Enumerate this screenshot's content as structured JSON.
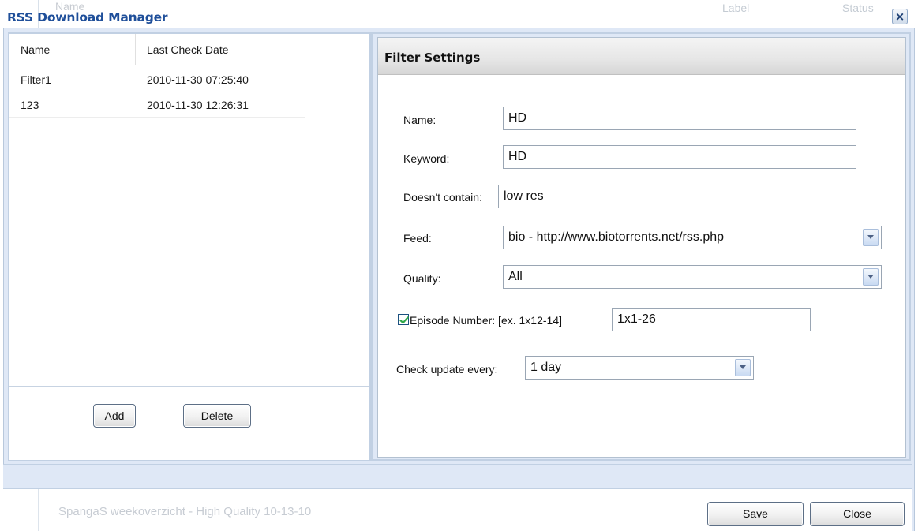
{
  "dialog": {
    "title": "RSS Download Manager",
    "close_glyph": "×"
  },
  "background": {
    "behind_title": "Name",
    "header_label": "Label",
    "header_status": "Status",
    "status_text": "SpangaS weekoverzicht - High Quality 10-13-10"
  },
  "filters": {
    "columns": [
      "Name",
      "Last Check Date"
    ],
    "rows": [
      {
        "name": "Filter1",
        "date": "2010-11-30 07:25:40"
      },
      {
        "name": "123",
        "date": "2010-11-30 12:26:31"
      }
    ],
    "add_label": "Add",
    "delete_label": "Delete"
  },
  "settings": {
    "header": "Filter Settings",
    "name_label": "Name:",
    "name_value": "HD",
    "keyword_label": "Keyword:",
    "keyword_value": "HD",
    "exclude_label": "Doesn't contain:",
    "exclude_value": "low res",
    "feed_label": "Feed:",
    "feed_value": "bio - http://www.biotorrents.net/rss.php",
    "quality_label": "Quality:",
    "quality_value": "All",
    "episode_checked": true,
    "episode_label": "Episode Number: [ex. 1x12-14]",
    "episode_value": "1x1-26",
    "update_label": "Check update every:",
    "update_value": "1 day"
  },
  "footer": {
    "save_label": "Save",
    "close_label": "Close"
  },
  "colors": {
    "title": "#1f4f9a",
    "panel_bg": "#dfe8f6",
    "check": "#2fa84a"
  }
}
